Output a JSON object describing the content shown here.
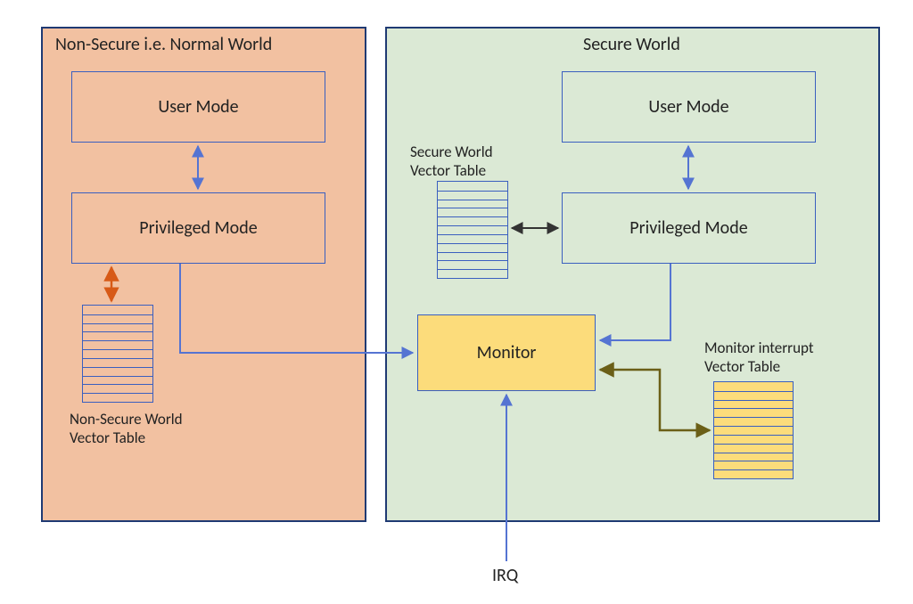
{
  "titles": {
    "normal_world": "Non-Secure i.e. Normal World",
    "secure_world": "Secure World"
  },
  "boxes": {
    "nw_user": "User Mode",
    "nw_priv": "Privileged Mode",
    "sw_user": "User Mode",
    "sw_priv": "Privileged Mode",
    "monitor": "Monitor"
  },
  "labels": {
    "nw_vector": "Non-Secure World\nVector Table",
    "sw_vector": "Secure World\nVector Table",
    "monitor_vector": "Monitor interrupt\nVector Table",
    "irq": "IRQ"
  },
  "colors": {
    "normal_bg": "#f2c1a1",
    "secure_bg": "#dbe9d5",
    "border": "#1f3a73",
    "box_border": "#3a5fbf",
    "monitor_bg": "#fcdc7b",
    "arrow_blue": "#5574d2",
    "arrow_orange": "#d75a17",
    "arrow_dark_olive": "#6b5f17",
    "arrow_dark": "#333333"
  }
}
